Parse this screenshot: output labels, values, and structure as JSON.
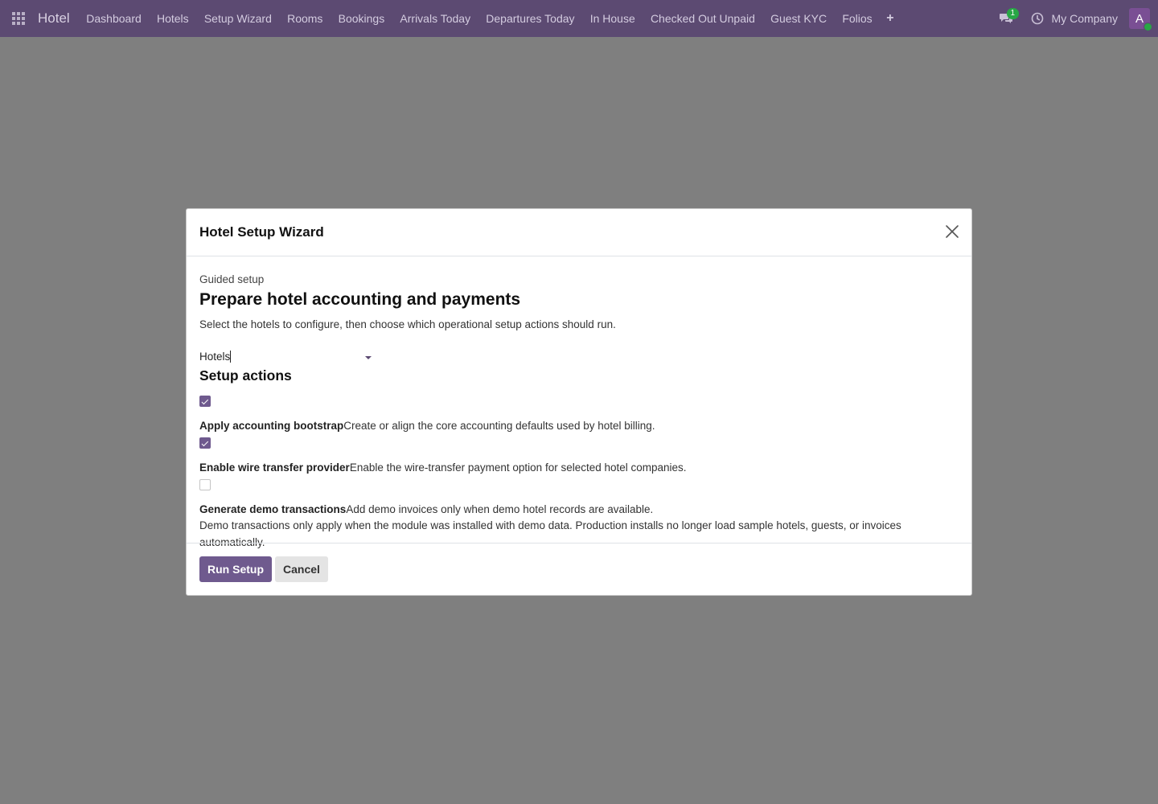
{
  "navbar": {
    "brand": "Hotel",
    "menu": [
      "Dashboard",
      "Hotels",
      "Setup Wizard",
      "Rooms",
      "Bookings",
      "Arrivals Today",
      "Departures Today",
      "In House",
      "Checked Out Unpaid",
      "Guest KYC",
      "Folios"
    ],
    "plus_icon": "+",
    "chat_badge": "1",
    "company": "My Company",
    "avatar_initial": "A",
    "colors": {
      "bar": "#5c4a72",
      "accent": "#6f5a8e",
      "status": "#28a745"
    }
  },
  "modal": {
    "title": "Hotel Setup Wizard",
    "eyebrow": "Guided setup",
    "headline": "Prepare hotel accounting and payments",
    "subtext": "Select the hotels to configure, then choose which operational setup actions should run.",
    "hotels_field_label": "Hotels",
    "section_title": "Setup actions",
    "actions": [
      {
        "title": "Apply accounting bootstrap",
        "description": "Create or align the core accounting defaults used by hotel billing.",
        "checked": true
      },
      {
        "title": "Enable wire transfer provider",
        "description": "Enable the wire-transfer payment option for selected hotel companies.",
        "checked": true
      },
      {
        "title": "Generate demo transactions",
        "description": "Add demo invoices only when demo hotel records are available.",
        "checked": false
      }
    ],
    "note": "Demo transactions only apply when the module was installed with demo data. Production installs no longer load sample hotels, guests, or invoices automatically.",
    "buttons": {
      "run": "Run Setup",
      "cancel": "Cancel"
    }
  }
}
